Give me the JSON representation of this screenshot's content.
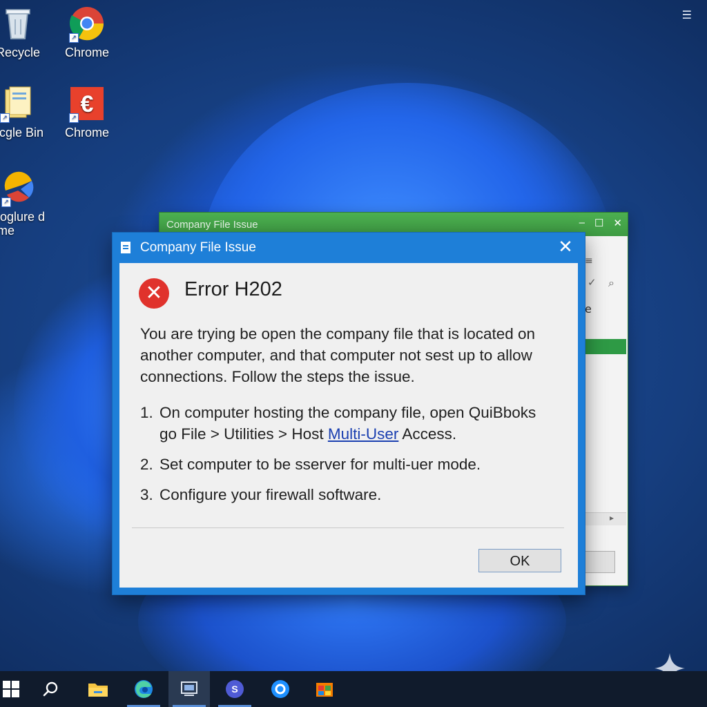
{
  "desktop": {
    "icons": [
      {
        "label": "Recycle",
        "icon": "recycle-bin-icon"
      },
      {
        "label": "Chrome",
        "icon": "chrome-icon"
      },
      {
        "label": "ocgle Bin",
        "icon": "folder-files-icon"
      },
      {
        "label": "Chrome",
        "icon": "red-app-icon"
      },
      {
        "label": "Googlure d\nhome",
        "icon": "chrome-colorful-icon"
      }
    ],
    "corner_glyph": "☰"
  },
  "background_window": {
    "title": "Company File Issue",
    "controls": {
      "minimize": "–",
      "maximize": "☐",
      "close": "✕"
    },
    "toolbar_glyphs": {
      "menu": "≡",
      "check": "✓",
      "search": "⌕"
    },
    "truncated_text": "e",
    "scroll_arrow": "▸"
  },
  "dialog": {
    "title": "Company File Issue",
    "close_glyph": "✕",
    "error_icon_glyph": "✕",
    "heading": "Error H202",
    "message": "You are trying be open the company file that is located on another computer, and that computer not sest up to allow connections. Follow the steps the issue.",
    "steps": [
      {
        "num": "1.",
        "line1": "On computer hosting the company file, open QuiBboks",
        "line2_pre": "go File > Utilities > Host ",
        "line2_link": "Multi-User",
        "line2_post": " Access."
      },
      {
        "num": "2.",
        "text": "Set computer to be sserver for multi-uer mode."
      },
      {
        "num": "3.",
        "text": "Configure your firewall software."
      }
    ],
    "ok_label": "OK"
  },
  "colors": {
    "dialog_accent": "#1e7fd8",
    "error_red": "#e0322c",
    "bg_window_green": "#4caf50",
    "taskbar": "#101b2c"
  },
  "taskbar": {
    "items": [
      "windows-start-icon",
      "search-icon",
      "file-explorer-icon",
      "edge-icon",
      "task-view-icon",
      "teams-icon",
      "cortana-icon",
      "store-icon"
    ]
  }
}
